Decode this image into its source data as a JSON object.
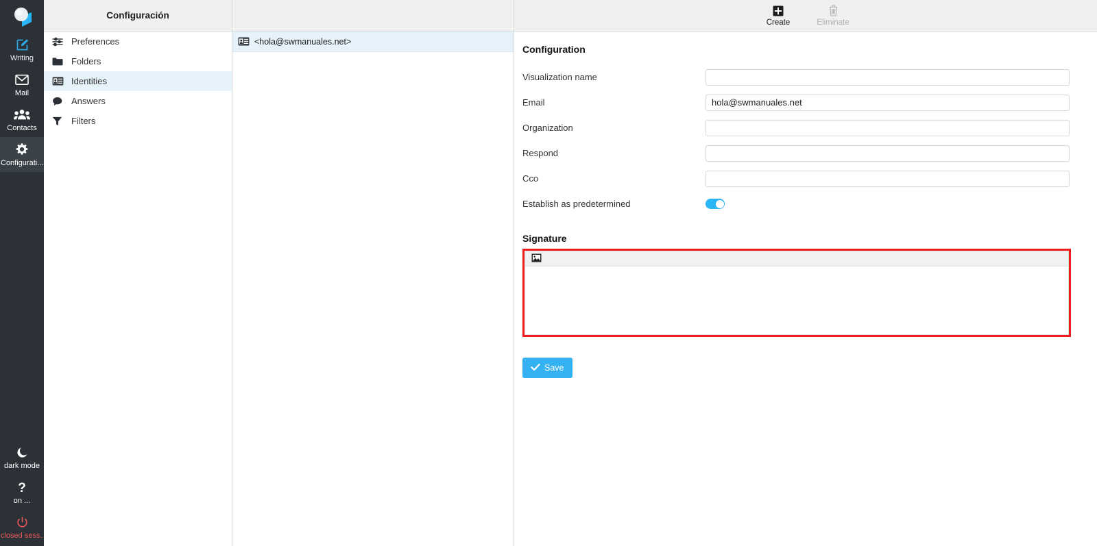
{
  "rail": {
    "logo_icon": "cube-logo-icon",
    "items": [
      {
        "label": "Writing",
        "icon": "compose-pencil-icon",
        "active": false
      },
      {
        "label": "Mail",
        "icon": "envelope-icon",
        "active": false
      },
      {
        "label": "Contacts",
        "icon": "contacts-people-icon",
        "active": false
      },
      {
        "label": "Configurati...",
        "icon": "gear-icon",
        "active": true
      }
    ],
    "bottom_items": [
      {
        "label": "dark mode",
        "icon": "moon-icon"
      },
      {
        "label": "on ...",
        "icon": "question-mark-icon"
      },
      {
        "label": "closed sess...",
        "icon": "power-icon"
      }
    ]
  },
  "settings": {
    "header_title": "Configuración",
    "items": [
      {
        "label": "Preferences",
        "icon": "sliders-icon",
        "selected": false
      },
      {
        "label": "Folders",
        "icon": "folder-icon",
        "selected": false
      },
      {
        "label": "Identities",
        "icon": "id-card-icon",
        "selected": true
      },
      {
        "label": "Answers",
        "icon": "speech-bubble-icon",
        "selected": false
      },
      {
        "label": "Filters",
        "icon": "funnel-icon",
        "selected": false
      }
    ]
  },
  "identity_list": {
    "rows": [
      {
        "label": "<hola@swmanuales.net>",
        "icon": "id-card-icon",
        "selected": true
      }
    ]
  },
  "toolbar": {
    "create_label": "Create",
    "create_icon": "plus-square-icon",
    "eliminate_label": "Eliminate",
    "eliminate_icon": "trash-icon"
  },
  "form": {
    "section_title": "Configuration",
    "fields": [
      {
        "label": "Visualization name",
        "value": "",
        "placeholder": ""
      },
      {
        "label": "Email",
        "value": "hola@swmanuales.net",
        "placeholder": ""
      },
      {
        "label": "Organization",
        "value": "",
        "placeholder": ""
      },
      {
        "label": "Respond",
        "value": "",
        "placeholder": ""
      },
      {
        "label": "Cco",
        "value": "",
        "placeholder": ""
      }
    ],
    "toggle": {
      "label": "Establish as predetermined",
      "on": true
    }
  },
  "signature": {
    "title": "Signature",
    "toolbar_icon": "insert-image-icon",
    "content": "",
    "highlighted": true,
    "highlight_color": "#ee1c1c"
  },
  "actions": {
    "save_label": "Save",
    "save_icon": "check-icon"
  },
  "colors": {
    "accent": "#33b1f0",
    "rail_bg": "#2b3136",
    "selection": "#e6f3fb",
    "header_bg": "#f0f0f0",
    "danger": "#e8565a",
    "annotation": "#ee1c1c"
  }
}
